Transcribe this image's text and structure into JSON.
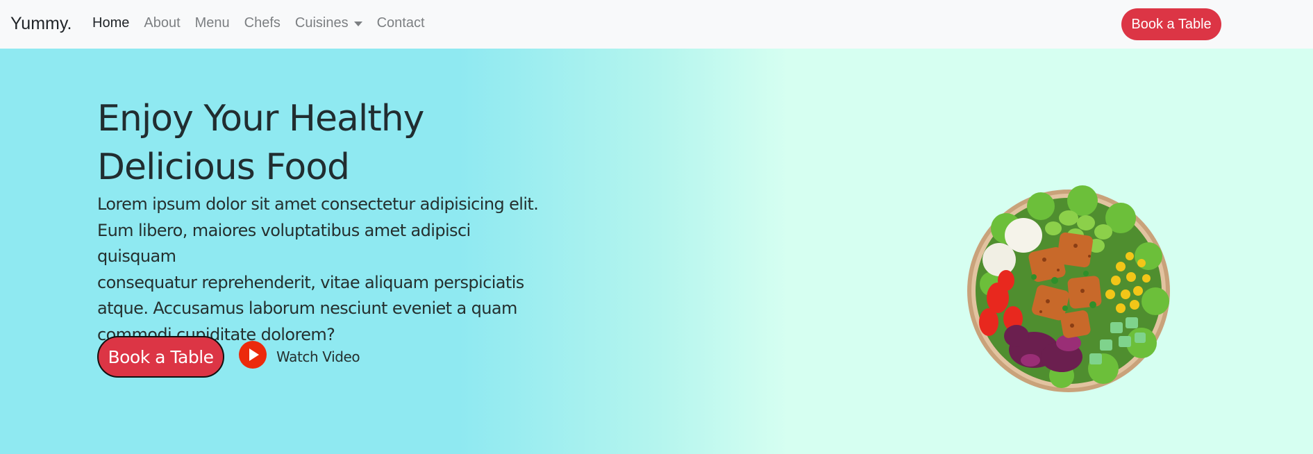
{
  "navbar": {
    "brand": "Yummy.",
    "items": [
      {
        "label": "Home",
        "active": true
      },
      {
        "label": "About",
        "active": false
      },
      {
        "label": "Menu",
        "active": false
      },
      {
        "label": "Chefs",
        "active": false
      },
      {
        "label": "Cuisines",
        "active": false,
        "dropdown": true
      },
      {
        "label": "Contact",
        "active": false
      }
    ],
    "cta": "Book a Table"
  },
  "hero": {
    "title_line1": "Enjoy Your Healthy",
    "title_line2": "Delicious Food",
    "text_lines": [
      "Lorem ipsum dolor sit amet consectetur adipisicing elit.",
      "Eum libero, maiores voluptatibus amet adipisci quisquam",
      "consequatur reprehenderit, vitae aliquam perspiciatis",
      "atque. Accusamus laborum nesciunt eveniet a quam",
      "commodi cupiditate dolorem?"
    ],
    "book_button": "Book a Table",
    "watch_label": "Watch Video"
  },
  "colors": {
    "accent": "#dc3545",
    "play": "#ec2a0c",
    "hero_left": "#8fe9f1",
    "hero_right": "#d6fff1"
  },
  "icons": {
    "play": "play-icon",
    "dropdown": "chevron-down-icon",
    "food_image": "salad-bowl-image"
  }
}
